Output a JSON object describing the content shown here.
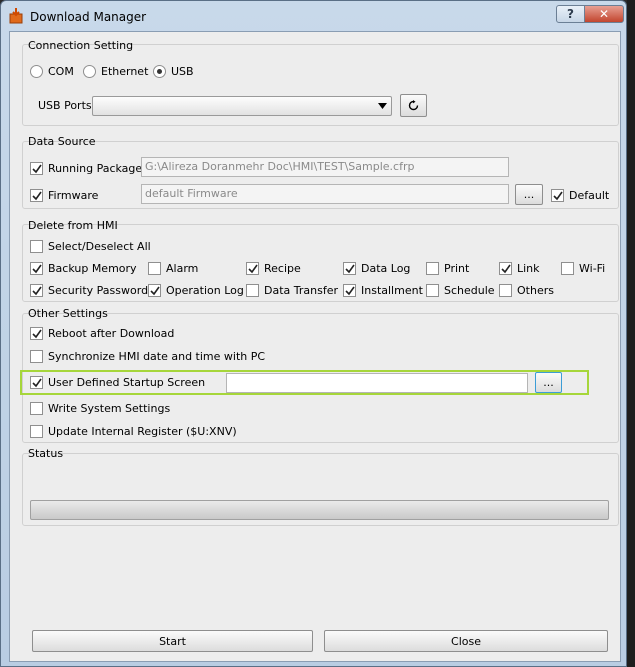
{
  "window": {
    "title": "Download Manager"
  },
  "connection": {
    "title": "Connection Setting",
    "options": [
      "COM",
      "Ethernet",
      "USB"
    ],
    "selected": "USB",
    "usb_ports_label": "USB Ports",
    "usb_ports_value": ""
  },
  "data_source": {
    "title": "Data Source",
    "running_package_label": "Running Package",
    "running_package_checked": true,
    "running_package_path": "G:\\Alireza Doranmehr Doc\\HMI\\TEST\\Sample.cfrp",
    "firmware_label": "Firmware",
    "firmware_checked": true,
    "firmware_value": "default Firmware",
    "browse_label": "...",
    "default_label": "Default",
    "default_checked": true
  },
  "delete_from_hmi": {
    "title": "Delete from HMI",
    "select_all_label": "Select/Deselect All",
    "row1": [
      {
        "label": "Backup Memory",
        "checked": true
      },
      {
        "label": "Alarm",
        "checked": false
      },
      {
        "label": "Recipe",
        "checked": true
      },
      {
        "label": "Data Log",
        "checked": true
      },
      {
        "label": "Print",
        "checked": false
      },
      {
        "label": "Link",
        "checked": true
      },
      {
        "label": "Wi-Fi",
        "checked": false
      }
    ],
    "row2": [
      {
        "label": "Security Password",
        "checked": true
      },
      {
        "label": "Operation Log",
        "checked": true
      },
      {
        "label": "Data Transfer",
        "checked": false
      },
      {
        "label": "Installment",
        "checked": true
      },
      {
        "label": "Schedule",
        "checked": false
      },
      {
        "label": "Others",
        "checked": false
      }
    ]
  },
  "other_settings": {
    "title": "Other Settings",
    "reboot_label": "Reboot after Download",
    "reboot_checked": true,
    "sync_label": "Synchronize HMI date and time with PC",
    "sync_checked": false,
    "startup_label": "User Defined Startup Screen",
    "startup_checked": true,
    "startup_value": "",
    "startup_browse": "...",
    "write_system_label": "Write System Settings",
    "write_system_checked": false,
    "update_register_label": "Update Internal Register ($U:XNV)",
    "update_register_checked": false
  },
  "status": {
    "title": "Status",
    "progress": 0
  },
  "footer": {
    "start_label": "Start",
    "close_label": "Close"
  },
  "colors": {
    "highlight": "#a6d63a",
    "client_bg": "#ededed",
    "titlebar": "#c8d9ea"
  }
}
